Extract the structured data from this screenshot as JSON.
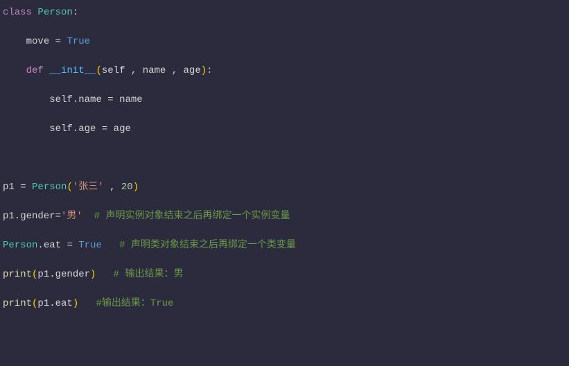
{
  "code": {
    "line1": {
      "kw_class": "class",
      "classname": "Person",
      "colon": ":"
    },
    "line3": {
      "indent": "    ",
      "var": "move",
      "eq": " = ",
      "val": "True"
    },
    "line5": {
      "indent": "    ",
      "kw_def": "def",
      "space": " ",
      "method": "__init__",
      "lparen": "(",
      "p1": "self",
      "c1": " , ",
      "p2": "name",
      "c2": " , ",
      "p3": "age",
      "rparen": ")",
      "colon": ":"
    },
    "line7": {
      "indent": "        ",
      "self": "self",
      "dot": ".",
      "attr": "name",
      "eq": " = ",
      "val": "name"
    },
    "line9": {
      "indent": "        ",
      "self": "self",
      "dot": ".",
      "attr": "age",
      "eq": " = ",
      "val": "age"
    },
    "line13": {
      "var": "p1",
      "eq": " = ",
      "cls": "Person",
      "lparen": "(",
      "str": "'张三'",
      "comma": " , ",
      "num": "20",
      "rparen": ")"
    },
    "line15": {
      "left": "p1.gender=",
      "str": "'男'",
      "space": "  ",
      "comment": "# 声明实例对象结束之后再绑定一个实例变量"
    },
    "line17": {
      "obj": "Person",
      "dot": ".",
      "attr": "eat",
      "eq": " = ",
      "val": "True",
      "space": "   ",
      "comment": "# 声明类对象结束之后再绑定一个类变量"
    },
    "line19": {
      "fn": "print",
      "lparen": "(",
      "arg": "p1.gender",
      "rparen": ")",
      "space": "   ",
      "comment": "# 输出结果：男"
    },
    "line21": {
      "fn": "print",
      "lparen": "(",
      "arg": "p1.eat",
      "rparen": ")",
      "space": "   ",
      "comment": "#输出结果：True"
    }
  }
}
